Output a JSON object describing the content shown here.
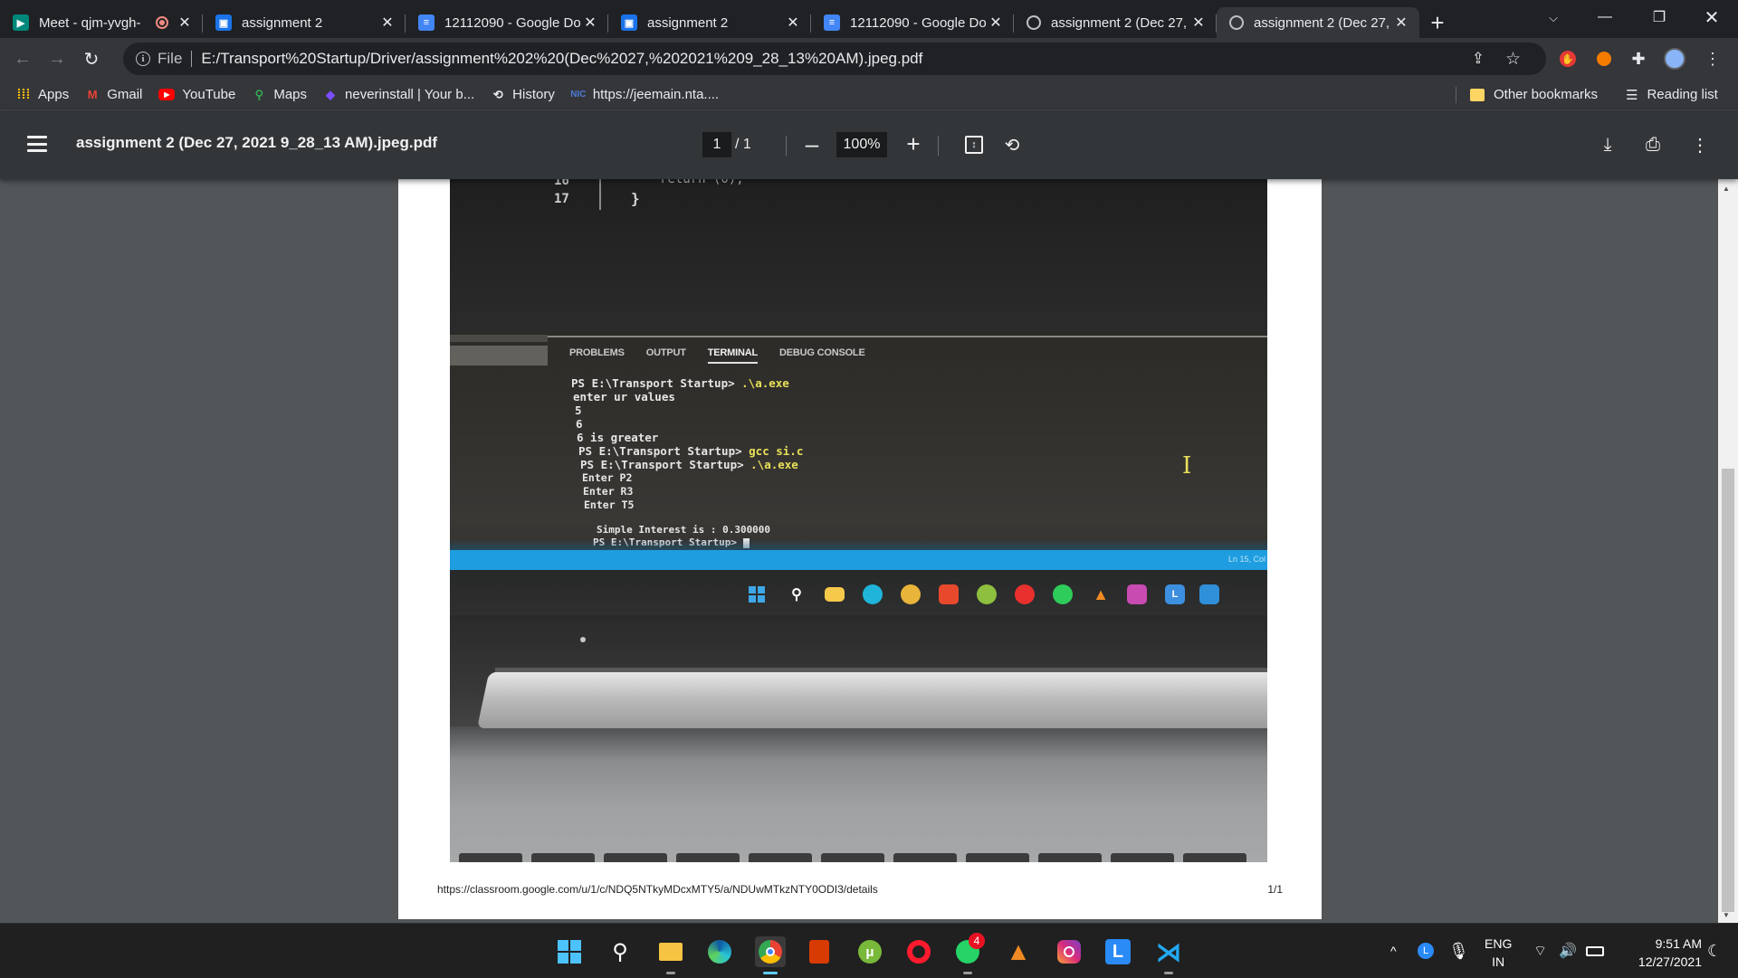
{
  "tabs": [
    {
      "title": "Meet - qjm-yvgh-",
      "favicon": "google-meet-icon",
      "recording": true,
      "active": false
    },
    {
      "title": "assignment 2",
      "favicon": "classroom-icon",
      "active": false
    },
    {
      "title": "12112090 - Google Do",
      "favicon": "google-docs-icon",
      "active": false
    },
    {
      "title": "assignment 2",
      "favicon": "classroom-icon",
      "active": false
    },
    {
      "title": "12112090 - Google Do",
      "favicon": "google-docs-icon",
      "active": false
    },
    {
      "title": "assignment 2 (Dec 27,",
      "favicon": "globe-icon",
      "active": false
    },
    {
      "title": "assignment 2 (Dec 27,",
      "favicon": "globe-icon",
      "active": true
    }
  ],
  "toolbar": {
    "url_scheme_label": "File",
    "url": "E:/Transport%20Startup/Driver/assignment%202%20(Dec%2027,%202021%209_28_13%20AM).jpeg.pdf"
  },
  "bookmarks": {
    "apps_label": "Apps",
    "items": [
      {
        "label": "Gmail",
        "icon": "gmail-icon"
      },
      {
        "label": "YouTube",
        "icon": "youtube-icon"
      },
      {
        "label": "Maps",
        "icon": "maps-icon"
      },
      {
        "label": "neverinstall | Your b...",
        "icon": "neverinstall-icon"
      },
      {
        "label": "History",
        "icon": "history-icon"
      },
      {
        "label": "https://jeemain.nta....",
        "icon": "nta-icon"
      }
    ],
    "other_bookmarks": "Other bookmarks",
    "reading_list": "Reading list"
  },
  "pdf": {
    "title": "assignment 2 (Dec 27, 2021 9_28_13 AM).jpeg.pdf",
    "current_page": "1",
    "page_of": "/ 1",
    "zoom": "100%",
    "footer_url": "https://classroom.google.com/u/1/c/NDQ5NTkyMDcxMTY5/a/NDUwMTkzNTY0ODI3/details",
    "footer_page": "1/1"
  },
  "photo": {
    "line_numbers": [
      "16",
      "17"
    ],
    "code_fragment": "return (0);",
    "closing_brace": "}",
    "panel_tabs": [
      "PROBLEMS",
      "OUTPUT",
      "TERMINAL",
      "DEBUG CONSOLE"
    ],
    "terminal": {
      "l1_prompt": "PS E:\\Transport Startup> ",
      "l1_cmd": ".\\a.exe",
      "l2": "enter ur values",
      "l3": "5",
      "l4": "6",
      "l5": "6 is greater",
      "l6_prompt": "PS E:\\Transport Startup> ",
      "l6_cmd": "gcc si.c",
      "l7_prompt": "PS E:\\Transport Startup> ",
      "l7_cmd": ".\\a.exe",
      "l8": "Enter P2",
      "l9": "Enter R3",
      "l10": "Enter T5",
      "l11": "Simple Interest is : 0.300000",
      "l12": "PS E:\\Transport Startup> ",
      "status": "Ln 15, Col"
    }
  },
  "taskbar": {
    "apps": [
      "windows-start-icon",
      "search-icon",
      "file-explorer-icon",
      "edge-icon",
      "chrome-icon",
      "office-icon",
      "utorrent-icon",
      "opera-icon",
      "whatsapp-icon",
      "vlc-icon",
      "instagram-icon",
      "l-app-icon",
      "vscode-icon"
    ],
    "whatsapp_badge": "4",
    "lang_top": "ENG",
    "lang_bottom": "IN",
    "time": "9:51 AM",
    "date": "12/27/2021"
  },
  "colors": {
    "chrome_dark": "#202124",
    "chrome_toolbar": "#35363a",
    "pdf_toolbar": "#323639",
    "pdf_bg": "#525659",
    "vscode_status": "#1e9ee0",
    "terminal_yellow": "#e8e05a"
  }
}
